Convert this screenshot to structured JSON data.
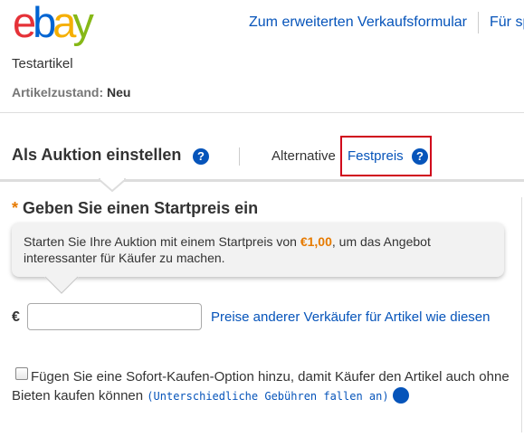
{
  "brand": {
    "logo_letters": [
      "e",
      "b",
      "a",
      "y"
    ],
    "logo_colors": [
      "#e53238",
      "#0064d2",
      "#f5af02",
      "#86b817"
    ],
    "link_color": "#0654ba",
    "accent_orange": "#e67a00",
    "highlight_red": "#d0021b"
  },
  "header": {
    "advanced_form_link": "Zum erweiterten Verkaufsformular",
    "second_link": "Für sp"
  },
  "item": {
    "title": "Testartikel",
    "condition_label": "Artikelzustand:",
    "condition_value": "Neu"
  },
  "format_tabs": {
    "auction_label": "Als Auktion einstellen",
    "alternative_label": "Alternative",
    "fixed_price_label": "Festpreis",
    "help_icon": "question-circle-icon"
  },
  "start_price": {
    "required_mark": "*",
    "heading": "Geben Sie einen Startpreis ein",
    "tip_before": "Starten Sie Ihre Auktion mit einem Startpreis von",
    "tip_price": "€1,00",
    "tip_after": ", um das Angebot interessanter für Käufer zu machen.",
    "currency_symbol": "€",
    "input_value": "",
    "other_prices_link": "Preise anderer Verkäufer für Artikel wie diesen"
  },
  "buy_it_now": {
    "checked": false,
    "label": "Fügen Sie eine Sofort-Kaufen-Option hinzu, damit Käufer den Artikel auch ohne Bieten kaufen können",
    "fee_link": "(Unterschiedliche Gebühren fallen an)"
  }
}
